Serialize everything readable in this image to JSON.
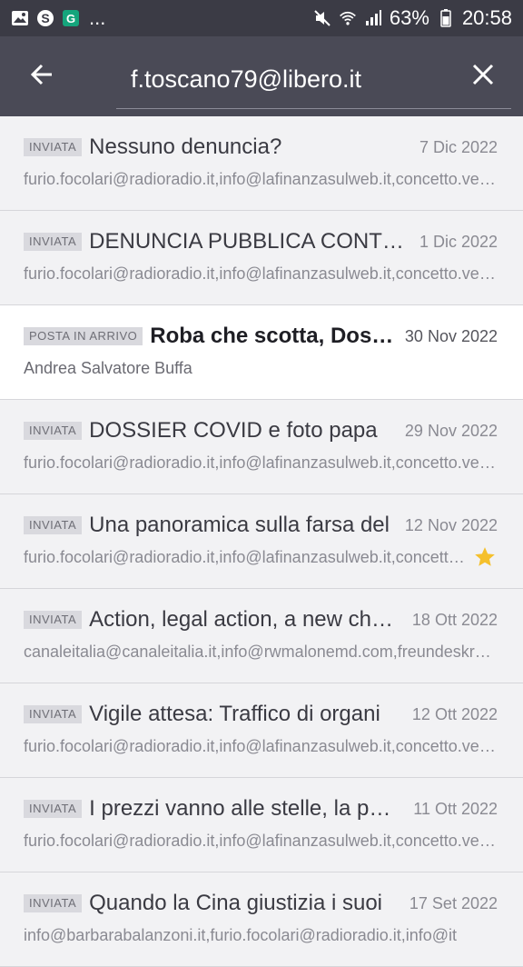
{
  "status_bar": {
    "left_icons": [
      "image-icon",
      "skype-icon",
      "grammarly-icon"
    ],
    "overflow": "...",
    "battery_percent": "63%",
    "time": "20:58",
    "right_icons": [
      "mute-icon",
      "wifi-icon",
      "signal-icon",
      "battery-icon"
    ]
  },
  "app_bar": {
    "search_value": "f.toscano79@libero.it",
    "back_icon": "arrow-left-icon",
    "clear_icon": "close-icon",
    "background": "#4a4a56"
  },
  "messages": [
    {
      "badge": "INVIATA",
      "subject": "Nessuno denuncia?",
      "date": "7 Dic 2022",
      "recipients": "furio.focolari@radioradio.it,info@lafinanzasulweb.it,concetto.vecchio@repubblica.it",
      "unread": false,
      "starred": false
    },
    {
      "badge": "INVIATA",
      "subject": "DENUNCIA PUBBLICA CONTRO",
      "date": "1 Dic 2022",
      "recipients": "furio.focolari@radioradio.it,info@lafinanzasulweb.it,concetto.vecchio@repubblica.it",
      "unread": false,
      "starred": false
    },
    {
      "badge": "POSTA IN ARRIVO",
      "subject": "Roba che scotta, Dossier",
      "date": "30 Nov 2022",
      "recipients": "Andrea Salvatore Buffa",
      "unread": true,
      "starred": false
    },
    {
      "badge": "INVIATA",
      "subject": "DOSSIER COVID e foto papa",
      "date": "29 Nov 2022",
      "recipients": "furio.focolari@radioradio.it,info@lafinanzasulweb.it,concetto.vecchio@repubblica.it",
      "unread": false,
      "starred": false
    },
    {
      "badge": "INVIATA",
      "subject": "Una panoramica sulla farsa del",
      "date": "12 Nov 2022",
      "recipients": "furio.focolari@radioradio.it,info@lafinanzasulweb.it,concetto.vecchio@repubblica.it",
      "unread": false,
      "starred": true
    },
    {
      "badge": "INVIATA",
      "subject": "Action, legal action, a new chapter",
      "date": "18 Ott 2022",
      "recipients": "canaleitalia@canaleitalia.it,info@rwmalonemd.com,freundeskreis@",
      "unread": false,
      "starred": false
    },
    {
      "badge": "INVIATA",
      "subject": "Vigile attesa: Traffico di organi",
      "date": "12 Ott 2022",
      "recipients": "furio.focolari@radioradio.it,info@lafinanzasulweb.it,concetto.vecchio@repubblica.it",
      "unread": false,
      "starred": false
    },
    {
      "badge": "INVIATA",
      "subject": "I prezzi vanno alle stelle, la povertà",
      "date": "11 Ott 2022",
      "recipients": "furio.focolari@radioradio.it,info@lafinanzasulweb.it,concetto.vecchio@repubblica.it",
      "unread": false,
      "starred": false
    },
    {
      "badge": "INVIATA",
      "subject": "Quando la Cina giustizia i suoi",
      "date": "17 Set 2022",
      "recipients": "info@barbarabalanzoni.it,furio.focolari@radioradio.it,info@it",
      "unread": false,
      "starred": false
    }
  ],
  "colors": {
    "status_bar": "#3b3b45",
    "list_background": "#f2f2f4",
    "unread_background": "#ffffff",
    "star": "#f5c02c"
  }
}
